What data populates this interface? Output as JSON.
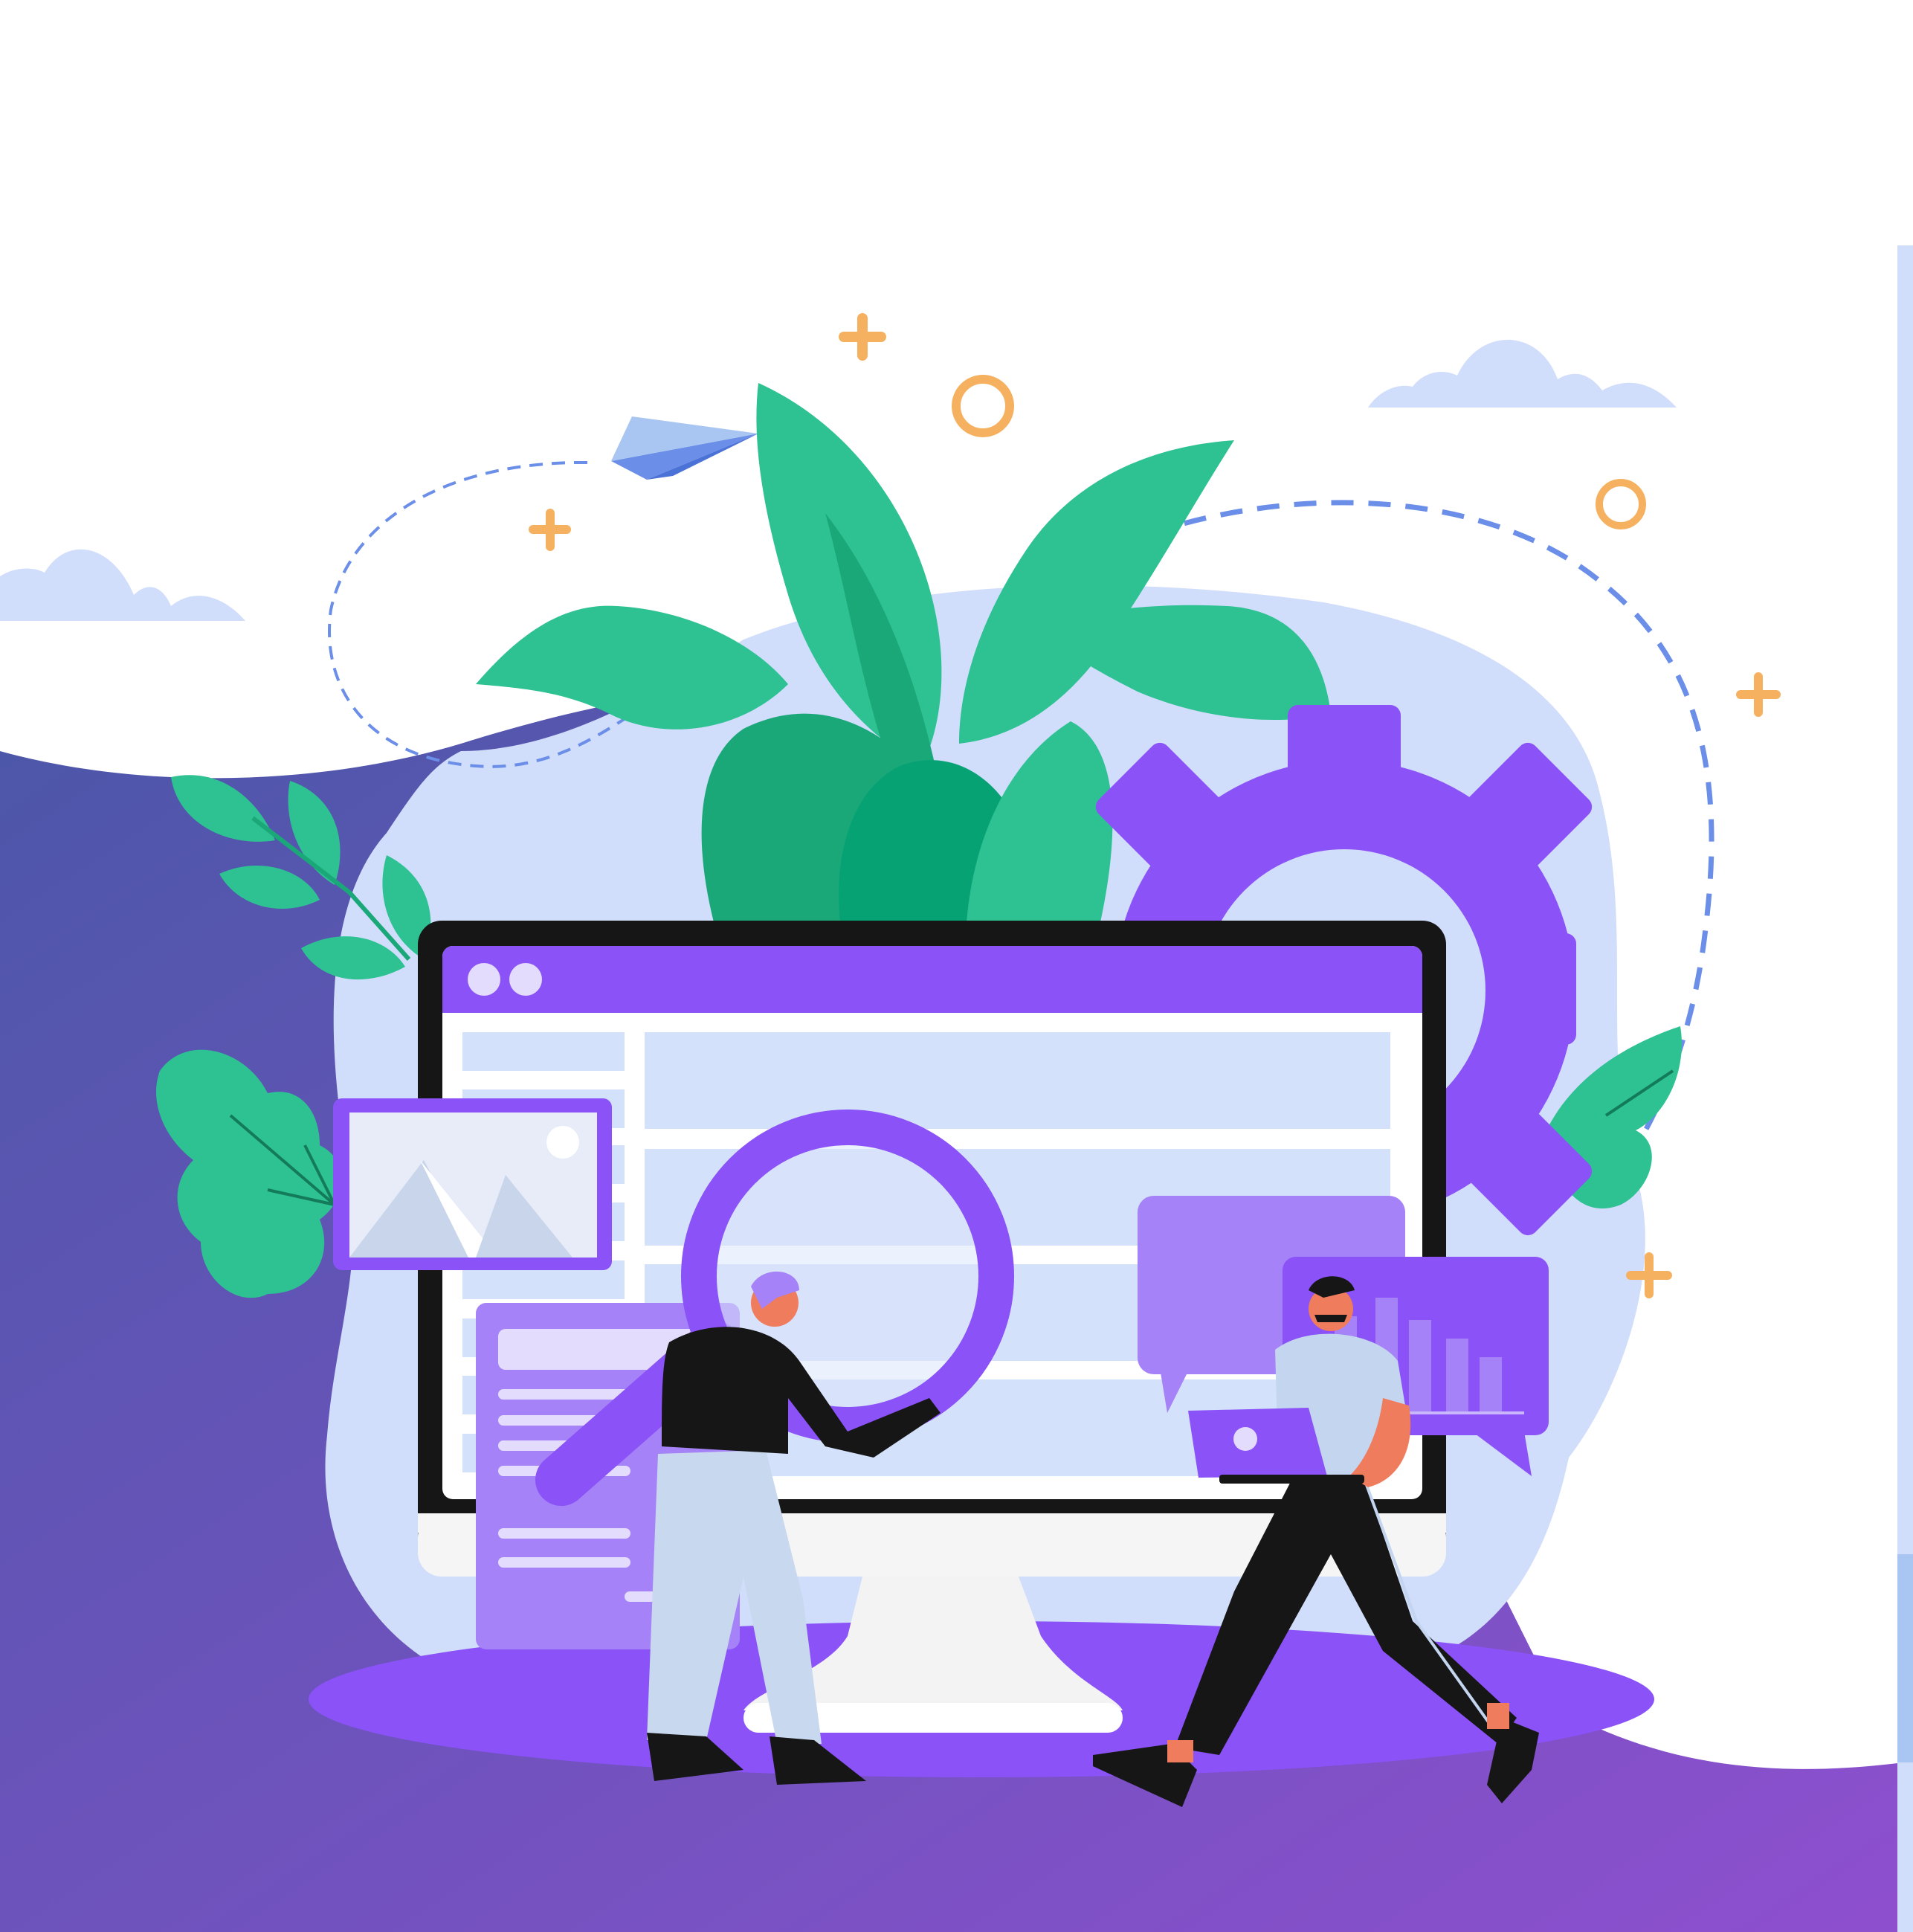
{
  "illustration": {
    "subject": "website-seo-analysis",
    "icons": [
      "paper-plane-icon",
      "gear-icon",
      "magnifier-icon",
      "image-icon",
      "bar-chart-icon",
      "laptop-icon",
      "plant-icon",
      "cloud-icon",
      "sparkle-icon",
      "ring-icon"
    ],
    "characters": [
      "person-with-magnifier",
      "person-with-laptop"
    ]
  },
  "colors": {
    "purple": "#8a52f7",
    "purple_light": "#a582f7",
    "purple_pale": "#e4dcfc",
    "navy": "#4b57a8",
    "violet": "#8e4fcf",
    "blob": "#d0ddfb",
    "green": "#2ec192",
    "green_dark": "#1ba879",
    "green_deep": "#06a274",
    "orange": "#f5b160",
    "dash": "#6b8ee8",
    "monitor_bezel": "#161616",
    "screen_row": "#d4e1fb",
    "cloud": "#d0ddfb",
    "skin": "#f07c5e",
    "shirt_light": "#c3d5ef",
    "pants_light": "#c8d8ee",
    "dark": "#161616"
  }
}
